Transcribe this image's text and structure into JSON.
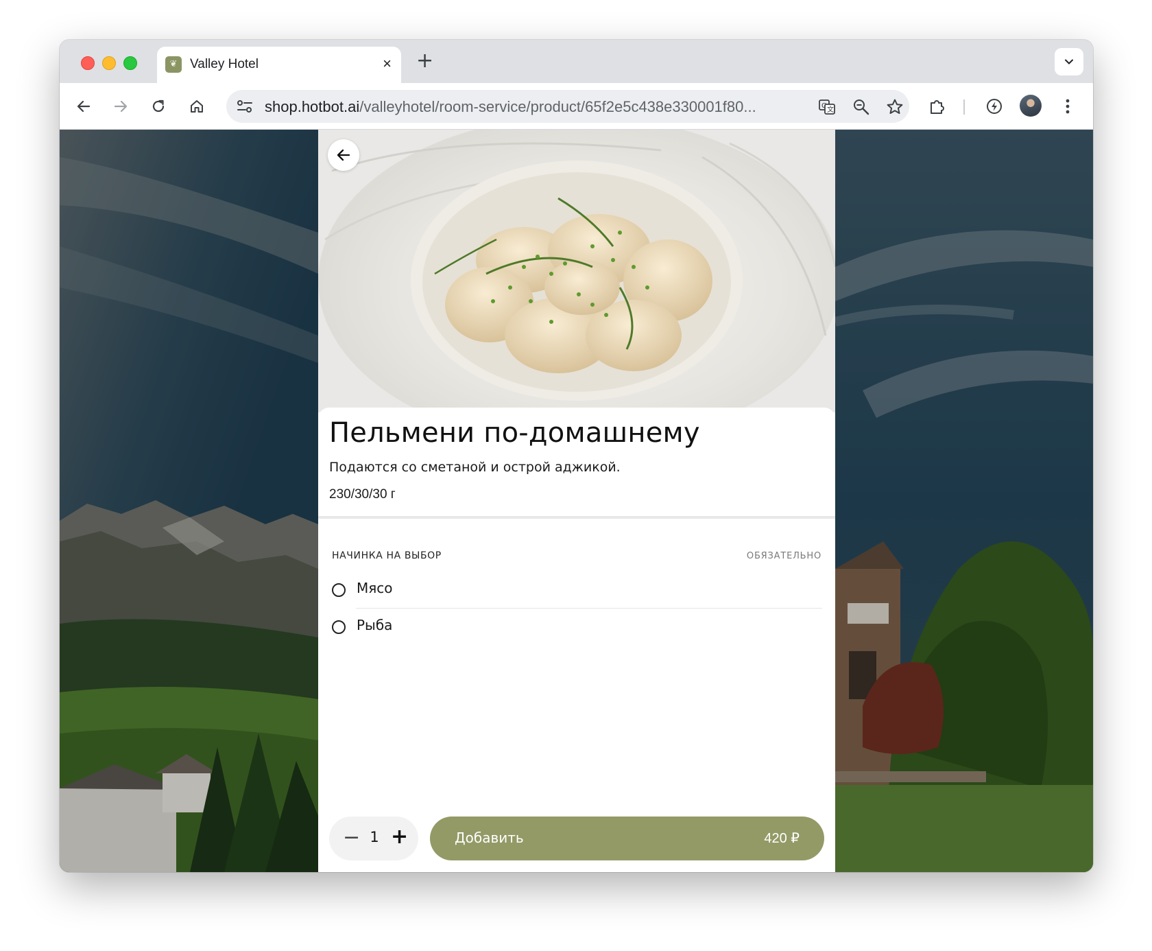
{
  "browser": {
    "tab": {
      "title": "Valley Hotel",
      "favicon_icon": "valley-hotel-leaf-icon",
      "close_label": "×"
    },
    "new_tab_label": "+",
    "url": {
      "domain": "shop.hotbot.ai",
      "path": "/valleyhotel/room-service/product/65f2e5c438e330001f80..."
    },
    "toolbar_icons": [
      "back-arrow-icon",
      "forward-arrow-icon",
      "reload-icon",
      "home-icon",
      "site-settings-icon",
      "translate-icon",
      "zoom-icon",
      "bookmark-star-icon",
      "extensions-icon",
      "performance-icon",
      "profile-avatar",
      "more-vert-icon"
    ]
  },
  "product": {
    "title": "Пельмени по-домашнему",
    "description": "Подаются со сметаной и острой аджикой.",
    "weight": "230/30/30 г",
    "options_group": {
      "title": "НАЧИНКА НА ВЫБОР",
      "required_label": "ОБЯЗАТЕЛЬНО",
      "options": [
        {
          "label": "Мясо",
          "selected": false
        },
        {
          "label": "Рыба",
          "selected": false
        }
      ]
    },
    "quantity": {
      "minus_label": "−",
      "value": "1",
      "plus_label": "+"
    },
    "add_button": {
      "label": "Добавить",
      "price": "420 ₽"
    }
  },
  "colors": {
    "accent": "#939a66",
    "panel_bg": "#ffffff"
  }
}
